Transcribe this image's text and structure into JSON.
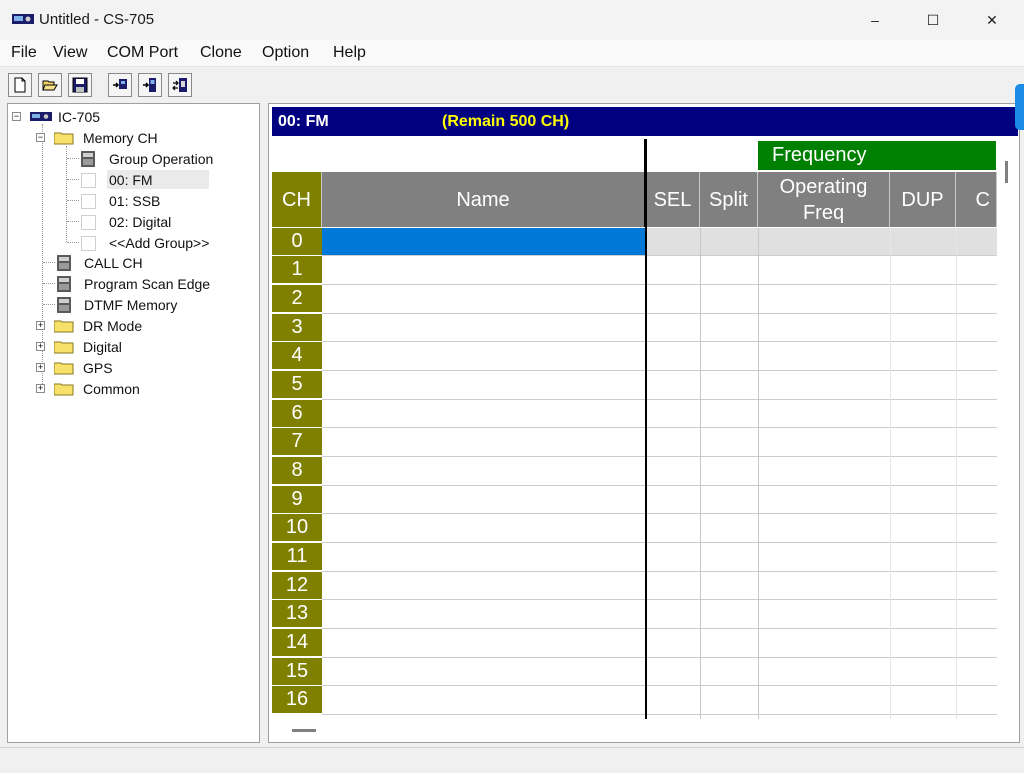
{
  "window": {
    "title": "Untitled - CS-705",
    "minimize": "–",
    "maximize": "☐",
    "close": "✕"
  },
  "menu": [
    "File",
    "View",
    "COM Port",
    "Clone",
    "Option",
    "Help"
  ],
  "toolbar": {
    "buttons": [
      "new-file-icon",
      "open-folder-icon",
      "save-icon",
      "read-from-radio-icon",
      "write-to-radio-icon",
      "transfer-icon"
    ]
  },
  "tree": {
    "root": "IC-705",
    "memory_ch": "Memory CH",
    "group_operation": "Group Operation",
    "groups": [
      "00: FM",
      "01: SSB",
      "02: Digital",
      "<<Add Group>>"
    ],
    "call_ch": "CALL CH",
    "program_scan_edge": "Program Scan Edge",
    "dtmf_memory": "DTMF Memory",
    "dr_mode": "DR Mode",
    "digital": "Digital",
    "gps": "GPS",
    "common": "Common"
  },
  "grid": {
    "group_label": "00: FM",
    "remain": "(Remain  500 CH)",
    "freq_group": "Frequency",
    "headers": {
      "ch": "CH",
      "name": "Name",
      "sel": "SEL",
      "split": "Split",
      "op_freq_1": "Operating",
      "op_freq_2": "Freq",
      "dup": "DUP",
      "cut": "C"
    },
    "channels": [
      "0",
      "1",
      "2",
      "3",
      "4",
      "5",
      "6",
      "7",
      "8",
      "9",
      "10",
      "11",
      "12",
      "13",
      "14",
      "15",
      "16"
    ],
    "selected_row": "0"
  },
  "colors": {
    "status_bg": "#000080",
    "remain_text": "#ffff00",
    "freq_header": "#008000",
    "ch_cell": "#808000",
    "header_gray": "#808080",
    "selected_cell": "#0078d7"
  }
}
